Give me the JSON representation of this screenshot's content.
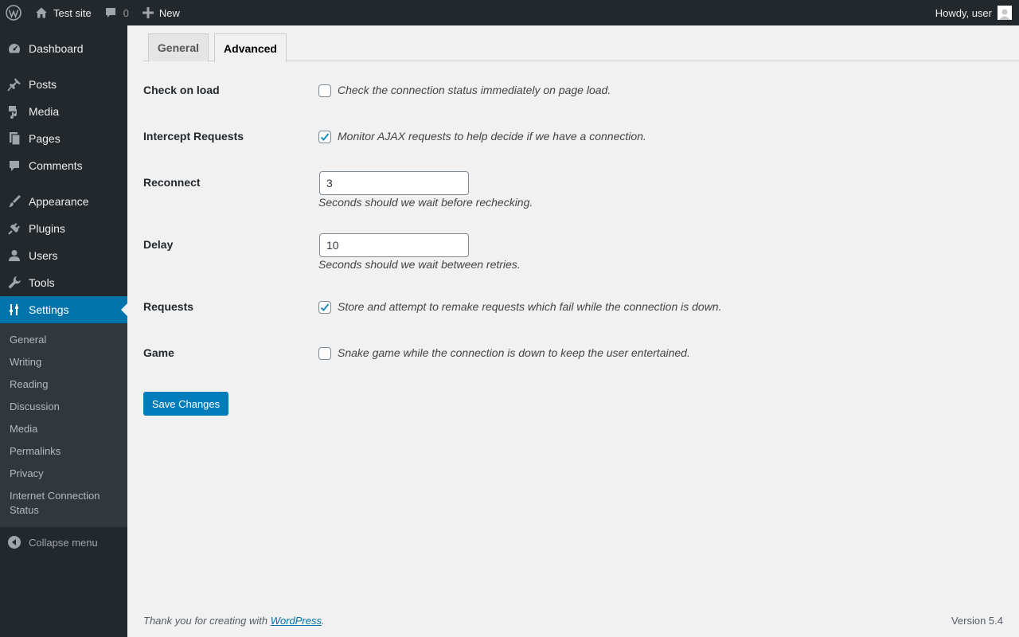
{
  "adminbar": {
    "site_name": "Test site",
    "comments_count": "0",
    "new_label": "New",
    "greeting": "Howdy, user"
  },
  "sidebar": {
    "items": [
      {
        "label": "Dashboard",
        "icon": "dashboard-icon"
      },
      {
        "label": "Posts",
        "icon": "pin-icon"
      },
      {
        "label": "Media",
        "icon": "media-icon"
      },
      {
        "label": "Pages",
        "icon": "pages-icon"
      },
      {
        "label": "Comments",
        "icon": "comment-icon"
      },
      {
        "label": "Appearance",
        "icon": "brush-icon"
      },
      {
        "label": "Plugins",
        "icon": "plug-icon"
      },
      {
        "label": "Users",
        "icon": "user-icon"
      },
      {
        "label": "Tools",
        "icon": "wrench-icon"
      },
      {
        "label": "Settings",
        "icon": "sliders-icon"
      }
    ],
    "submenu": [
      "General",
      "Writing",
      "Reading",
      "Discussion",
      "Media",
      "Permalinks",
      "Privacy",
      "Internet Connection Status"
    ],
    "collapse_label": "Collapse menu"
  },
  "tabs": [
    "General",
    "Advanced"
  ],
  "settings": {
    "check_on_load": {
      "label": "Check on load",
      "checked": false,
      "description": "Check the connection status immediately on page load."
    },
    "intercept_requests": {
      "label": "Intercept Requests",
      "checked": true,
      "description": "Monitor AJAX requests to help decide if we have a connection."
    },
    "reconnect": {
      "label": "Reconnect",
      "value": "3",
      "help": "Seconds should we wait before rechecking."
    },
    "delay": {
      "label": "Delay",
      "value": "10",
      "help": "Seconds should we wait between retries."
    },
    "requests": {
      "label": "Requests",
      "checked": true,
      "description": "Store and attempt to remake requests which fail while the connection is down."
    },
    "game": {
      "label": "Game",
      "checked": false,
      "description": "Snake game while the connection is down to keep the user entertained."
    }
  },
  "save_label": "Save Changes",
  "footer": {
    "thanks_prefix": "Thank you for creating with ",
    "thanks_link": "WordPress",
    "thanks_suffix": ".",
    "version": "Version 5.4"
  },
  "colors": {
    "accent": "#0073aa",
    "adminbar_bg": "#23282d",
    "submenu_bg": "#32373c",
    "page_bg": "#f1f1f1",
    "button": "#007cba"
  }
}
